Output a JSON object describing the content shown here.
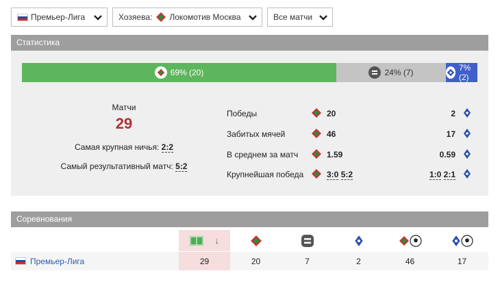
{
  "filters": {
    "league": "Премьер-Лига",
    "team_prefix": "Хозяева:",
    "team": "Локомотив Москва",
    "matches": "Все матчи"
  },
  "stats": {
    "header": "Статистика",
    "bar": {
      "win_label": "69% (20)",
      "draw_label": "24% (7)",
      "loss_label": "7% (2)",
      "win_fraction": 0.69,
      "draw_fraction": 0.24,
      "loss_fraction": 0.07
    },
    "matches_label": "Матчи",
    "matches_value": "29",
    "biggest_draw_label": "Самая крупная ничья:",
    "biggest_draw_value": "2:2",
    "highest_scoring_label": "Самый результативный матч:",
    "highest_scoring_value": "5:2",
    "rows": [
      {
        "label": "Победы",
        "left": "20",
        "right": "2"
      },
      {
        "label": "Забитых мячей",
        "left": "46",
        "right": "17"
      },
      {
        "label": "В среднем за матч",
        "left": "1.59",
        "right": "0.59"
      },
      {
        "label": "Крупнейшая победа",
        "left_a": "3:0",
        "left_b": "5:2",
        "right_a": "1:0",
        "right_b": "2:1"
      }
    ]
  },
  "competitions": {
    "header": "Соревнования",
    "sort_arrow": "↓",
    "row": {
      "name": "Премьер-Лига",
      "matches": "29",
      "wins": "20",
      "draws": "7",
      "losses": "2",
      "goals_for": "46",
      "goals_against": "17"
    }
  },
  "colors": {
    "win": "#5db55d",
    "draw": "#c4c4c4",
    "loss": "#3f5fc9",
    "accent": "#b1303a",
    "header": "#9e9e9e"
  }
}
